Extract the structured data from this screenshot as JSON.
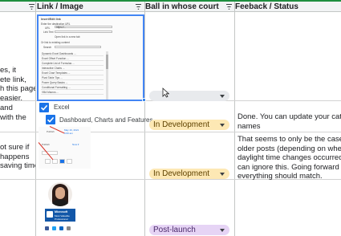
{
  "header": {
    "col_link": "Link / Image",
    "col_ball": "Ball in whose court",
    "col_feedback": "Feeback / Status"
  },
  "rows": [
    {
      "left_text": [
        "es, it",
        "ete link,",
        "h this page",
        "easier."
      ],
      "status": "",
      "feedback": []
    },
    {
      "left_text": [
        "and",
        "with the"
      ],
      "image": {
        "checkbox1": "Excel",
        "checkbox2": "Dashboard, Charts and Features"
      },
      "status": "In Development",
      "feedback": [
        "Done. You can update your categ",
        "names"
      ]
    },
    {
      "left_text": [
        "ot sure if",
        "happens",
        "saving time"
      ],
      "status": "In Development",
      "feedback": [
        "That seems to only be the case fo",
        "older posts (depending on when t",
        "daylight time changes occurred) -",
        "can ignore this. Going forward",
        "everything should match."
      ]
    },
    {
      "left_text": [],
      "image": {
        "badge_line1": "Microsoft",
        "badge_line2": "Most Valuable",
        "badge_line3": "Professional"
      },
      "status": "Post-launch",
      "feedback": []
    }
  ],
  "colors": {
    "in_development": "#fde8b4",
    "post_launch": "#e6d4f5",
    "selection": "#1a73e8",
    "header_bg": "#f1f3f4"
  },
  "icons": [
    "filter-icon",
    "dropdown-arrow-icon",
    "checkbox-checked-icon",
    "mouse-pointer-icon"
  ]
}
